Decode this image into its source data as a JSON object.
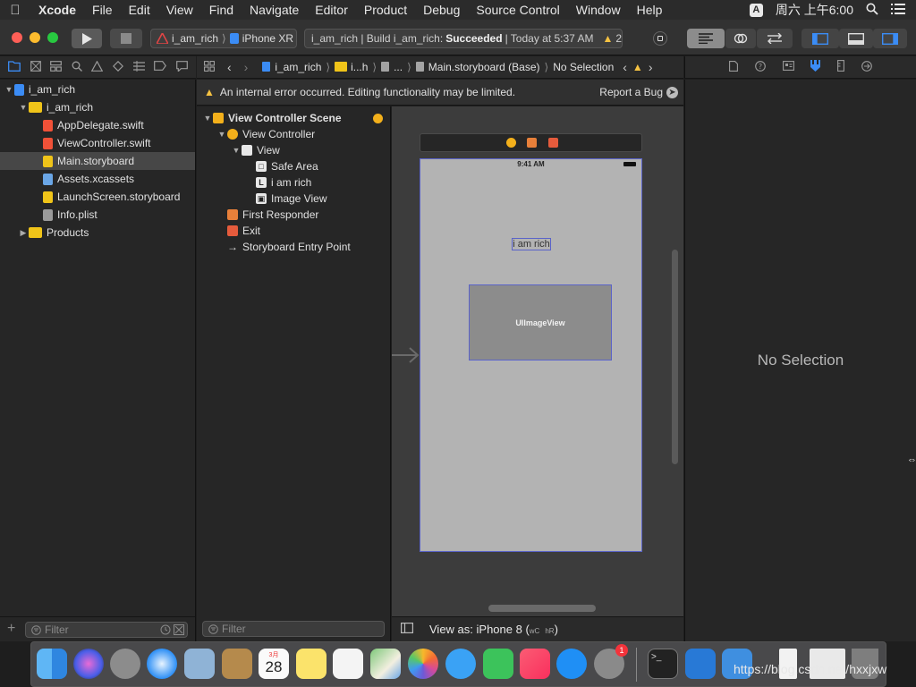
{
  "menubar": {
    "app_name": "Xcode",
    "items": [
      "File",
      "Edit",
      "View",
      "Find",
      "Navigate",
      "Editor",
      "Product",
      "Debug",
      "Source Control",
      "Window",
      "Help"
    ],
    "input_indicator": "A",
    "clock": "周六 上午6:00"
  },
  "toolbar": {
    "scheme_target": "i_am_rich",
    "scheme_device": "iPhone XR",
    "activity_prefix": "i_am_rich | Build i_am_rich:",
    "activity_status": "Succeeded",
    "activity_time": "| Today at 5:37 AM",
    "warning_count": "2"
  },
  "navigator": {
    "items": [
      {
        "label": "i_am_rich",
        "indent": 0,
        "disclosure": "open",
        "icon": "project",
        "selected": false
      },
      {
        "label": "i_am_rich",
        "indent": 1,
        "disclosure": "open",
        "icon": "folder",
        "selected": false
      },
      {
        "label": "AppDelegate.swift",
        "indent": 2,
        "disclosure": "",
        "icon": "swift",
        "selected": false
      },
      {
        "label": "ViewController.swift",
        "indent": 2,
        "disclosure": "",
        "icon": "swift",
        "selected": false
      },
      {
        "label": "Main.storyboard",
        "indent": 2,
        "disclosure": "",
        "icon": "storyboard",
        "selected": true
      },
      {
        "label": "Assets.xcassets",
        "indent": 2,
        "disclosure": "",
        "icon": "assets",
        "selected": false
      },
      {
        "label": "LaunchScreen.storyboard",
        "indent": 2,
        "disclosure": "",
        "icon": "storyboard",
        "selected": false
      },
      {
        "label": "Info.plist",
        "indent": 2,
        "disclosure": "",
        "icon": "plist",
        "selected": false
      },
      {
        "label": "Products",
        "indent": 1,
        "disclosure": "closed",
        "icon": "folder",
        "selected": false
      }
    ],
    "filter_placeholder": "Filter"
  },
  "jumpbar": {
    "crumbs": [
      "i_am_rich",
      "i...h",
      "...",
      "Main.storyboard (Base)",
      "No Selection"
    ]
  },
  "issue": {
    "message": "An internal error occurred. Editing functionality may be limited.",
    "report_label": "Report a Bug"
  },
  "outline": {
    "rows": [
      {
        "label": "View Controller Scene",
        "indent": 0,
        "disclosure": "open",
        "icon": "scene",
        "bold": true
      },
      {
        "label": "View Controller",
        "indent": 1,
        "disclosure": "open",
        "icon": "vc",
        "bold": false
      },
      {
        "label": "View",
        "indent": 2,
        "disclosure": "open",
        "icon": "view",
        "bold": false
      },
      {
        "label": "Safe Area",
        "indent": 3,
        "disclosure": "",
        "icon": "safearea",
        "bold": false
      },
      {
        "label": "i am rich",
        "indent": 3,
        "disclosure": "",
        "icon": "label",
        "bold": false
      },
      {
        "label": "Image View",
        "indent": 3,
        "disclosure": "",
        "icon": "imageview",
        "bold": false
      },
      {
        "label": "First Responder",
        "indent": 1,
        "disclosure": "",
        "icon": "responder",
        "bold": false
      },
      {
        "label": "Exit",
        "indent": 1,
        "disclosure": "",
        "icon": "exit",
        "bold": false
      },
      {
        "label": "Storyboard Entry Point",
        "indent": 1,
        "disclosure": "",
        "icon": "entry",
        "bold": false
      }
    ],
    "filter_placeholder": "Filter"
  },
  "canvas": {
    "status_time": "9:41 AM",
    "label_text": "i am rich",
    "imageview_text": "UIImageView",
    "view_as_label": "View as: iPhone 8 (",
    "size_class_w": "wC",
    "size_class_h": "hR",
    "view_as_close": ")"
  },
  "inspector": {
    "empty_text": "No Selection"
  },
  "dock": {
    "apps": [
      "finder",
      "siri",
      "launchpad",
      "safari",
      "preview",
      "contacts",
      "calendar",
      "notes",
      "reminders",
      "maps",
      "photos",
      "messages",
      "facetime",
      "music",
      "app-store",
      "system-preferences",
      "terminal",
      "xcode",
      "folder",
      "file",
      "textedit",
      "trash"
    ],
    "calendar_month": "3月",
    "calendar_day": "28",
    "system_prefs_badge": "1"
  },
  "watermark": "https://blog.csdn.net/hxxjxw"
}
